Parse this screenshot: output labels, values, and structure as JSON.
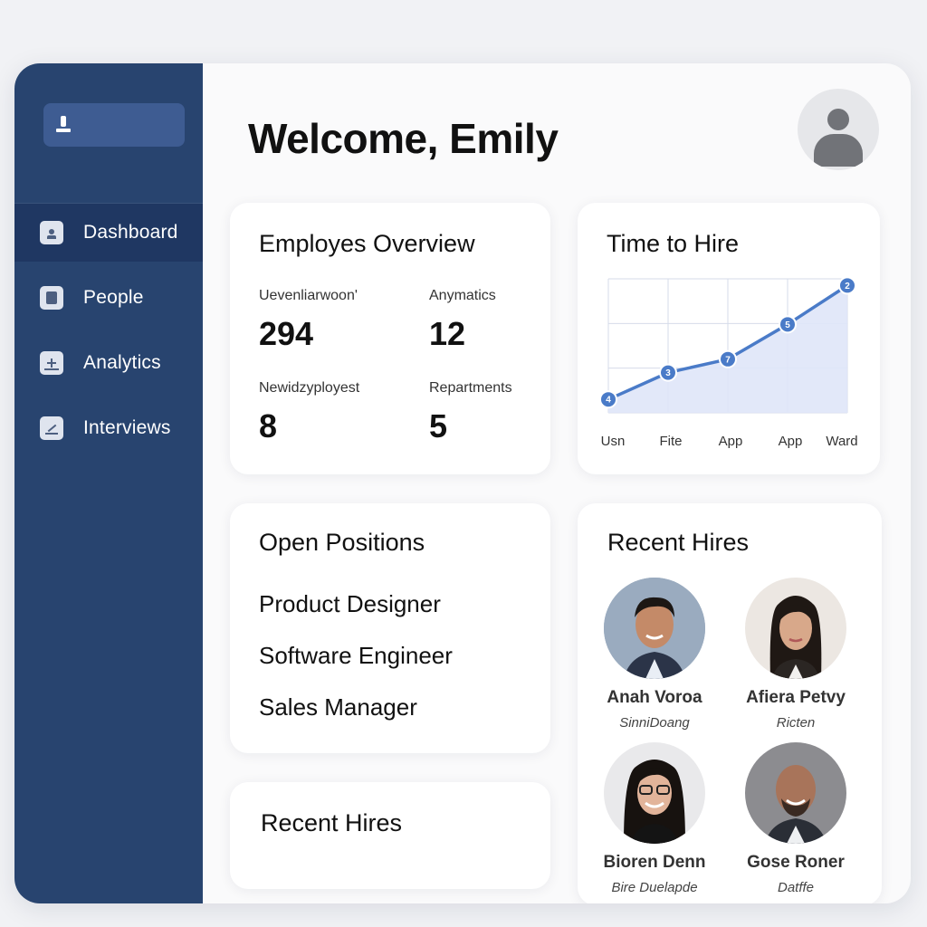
{
  "sidebar": {
    "items": [
      {
        "label": "Dashboard",
        "icon": "dashboard-icon",
        "active": true
      },
      {
        "label": "People",
        "icon": "people-icon",
        "active": false
      },
      {
        "label": "Analytics",
        "icon": "analytics-icon",
        "active": false
      },
      {
        "label": "Interviews",
        "icon": "interviews-icon",
        "active": false
      }
    ]
  },
  "header": {
    "title": "Welcome, Emily"
  },
  "overview": {
    "title": "Employes Overview",
    "stats": [
      {
        "label": "Uevenliarwoon'",
        "value": "294"
      },
      {
        "label": "Anymatics",
        "value": "12"
      },
      {
        "label": "Newidzyployest",
        "value": "8"
      },
      {
        "label": "Repartments",
        "value": "5"
      }
    ]
  },
  "time_to_hire": {
    "title": "Time to Hire"
  },
  "chart_data": {
    "type": "area",
    "title": "Time to Hire",
    "categories": [
      "Usn",
      "Fite",
      "App",
      "App",
      "Ward"
    ],
    "series": [
      {
        "values": [
          4,
          3,
          7,
          5,
          2
        ],
        "point_heights": [
          1.0,
          3.0,
          4.0,
          6.6,
          9.5
        ]
      }
    ],
    "colors": {
      "line": "#4a7bc8",
      "fill": "#dfe5f8",
      "grid": "#d6dbea"
    },
    "grid": true
  },
  "open_positions": {
    "title": "Open Positions",
    "items": [
      "Product Designer",
      "Software Engineer",
      "Sales Manager"
    ]
  },
  "recent_hires_small": {
    "title": "Recent Hires"
  },
  "recent_hires": {
    "title": "Recent Hires",
    "people": [
      {
        "name": "Anah Voroa",
        "role": "SinniDoang"
      },
      {
        "name": "Afiera Petvy",
        "role": "Ricten"
      },
      {
        "name": "Bioren Denn",
        "role": "Bire Duelapde"
      },
      {
        "name": "Gose Roner",
        "role": "Datffe"
      }
    ]
  },
  "colors": {
    "sidebar": "#28446f",
    "sidebar_active": "#1f3762",
    "accent": "#4a7bc8"
  }
}
